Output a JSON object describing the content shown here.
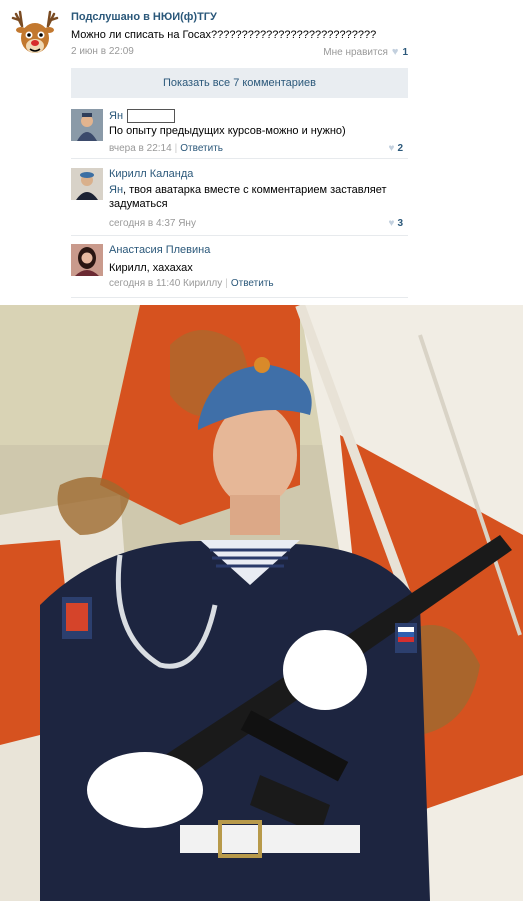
{
  "post": {
    "title": "Подслушано в НЮИ(ф)ТГУ",
    "text": "Можно ли списать на Госах???????????????????????????",
    "date": "2 июн в 22:09",
    "like_label": "Мне нравится",
    "like_count": "1",
    "avatar_icon": "deer-icon"
  },
  "comments_bar": {
    "show_all_label": "Показать все 7 комментариев"
  },
  "comments": [
    {
      "name": "Ян",
      "text": "По опыту предыдущих курсов-можно и нужно)",
      "date": "вчера в 22:14",
      "reply": "Ответить",
      "likes": "2"
    },
    {
      "name": "Кирилл Каланда",
      "text_mention": "Ян",
      "text": ", твоя аватарка вместе с комментарием заставляет задуматься",
      "date": "сегодня в 4:37 Яну",
      "likes": "3"
    },
    {
      "name": "Анастасия Плевина",
      "text": "Кирилл, хахахах",
      "date": "сегодня в 11:40 Кириллу",
      "reply": "Ответить"
    }
  ],
  "colors": {
    "link": "#2b587a",
    "meta": "#999999",
    "bar_bg": "#e9edf1",
    "heart": "#c3d0de"
  }
}
